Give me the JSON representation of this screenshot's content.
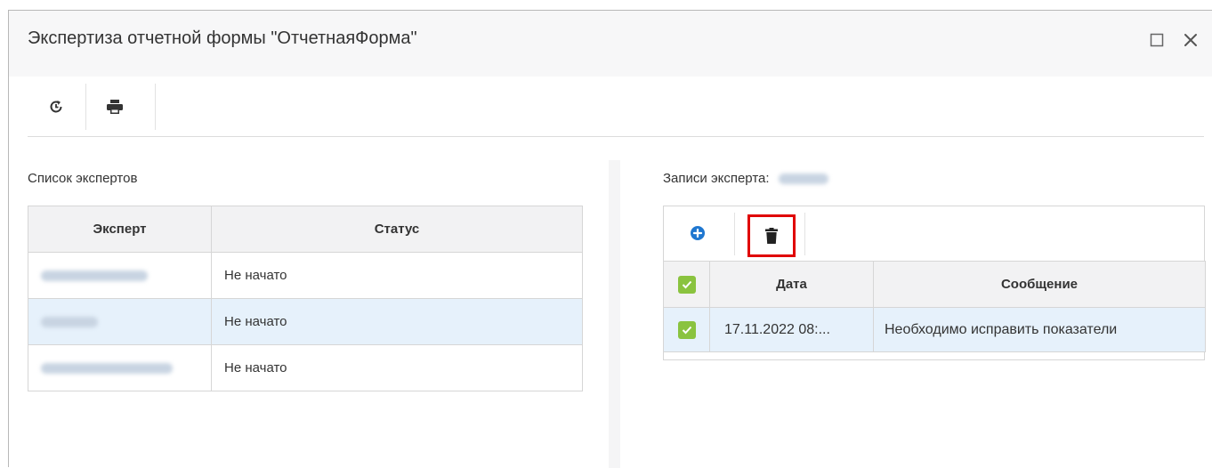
{
  "window": {
    "title": "Экспертиза отчетной формы \"ОтчетнаяФорма\""
  },
  "experts_panel": {
    "title": "Список экспертов",
    "columns": [
      "Эксперт",
      "Статус"
    ],
    "rows": [
      {
        "status": "Не начато",
        "selected": false
      },
      {
        "status": "Не начато",
        "selected": true
      },
      {
        "status": "Не начато",
        "selected": false
      }
    ]
  },
  "records_panel": {
    "title": "Записи эксперта:",
    "columns": [
      "Дата",
      "Сообщение"
    ],
    "rows": [
      {
        "date": "17.11.2022 08:...",
        "message": "Необходимо исправить показатели",
        "checked": true
      }
    ]
  },
  "colors": {
    "accent": "#1f77d0",
    "check": "#8ac33f",
    "highlight": "#e00000",
    "selected_row": "#e6f1fb"
  },
  "icons": [
    "maximize-icon",
    "close-icon",
    "refresh-icon",
    "print-icon",
    "add-circle-icon",
    "trash-icon",
    "checkmark-icon"
  ]
}
